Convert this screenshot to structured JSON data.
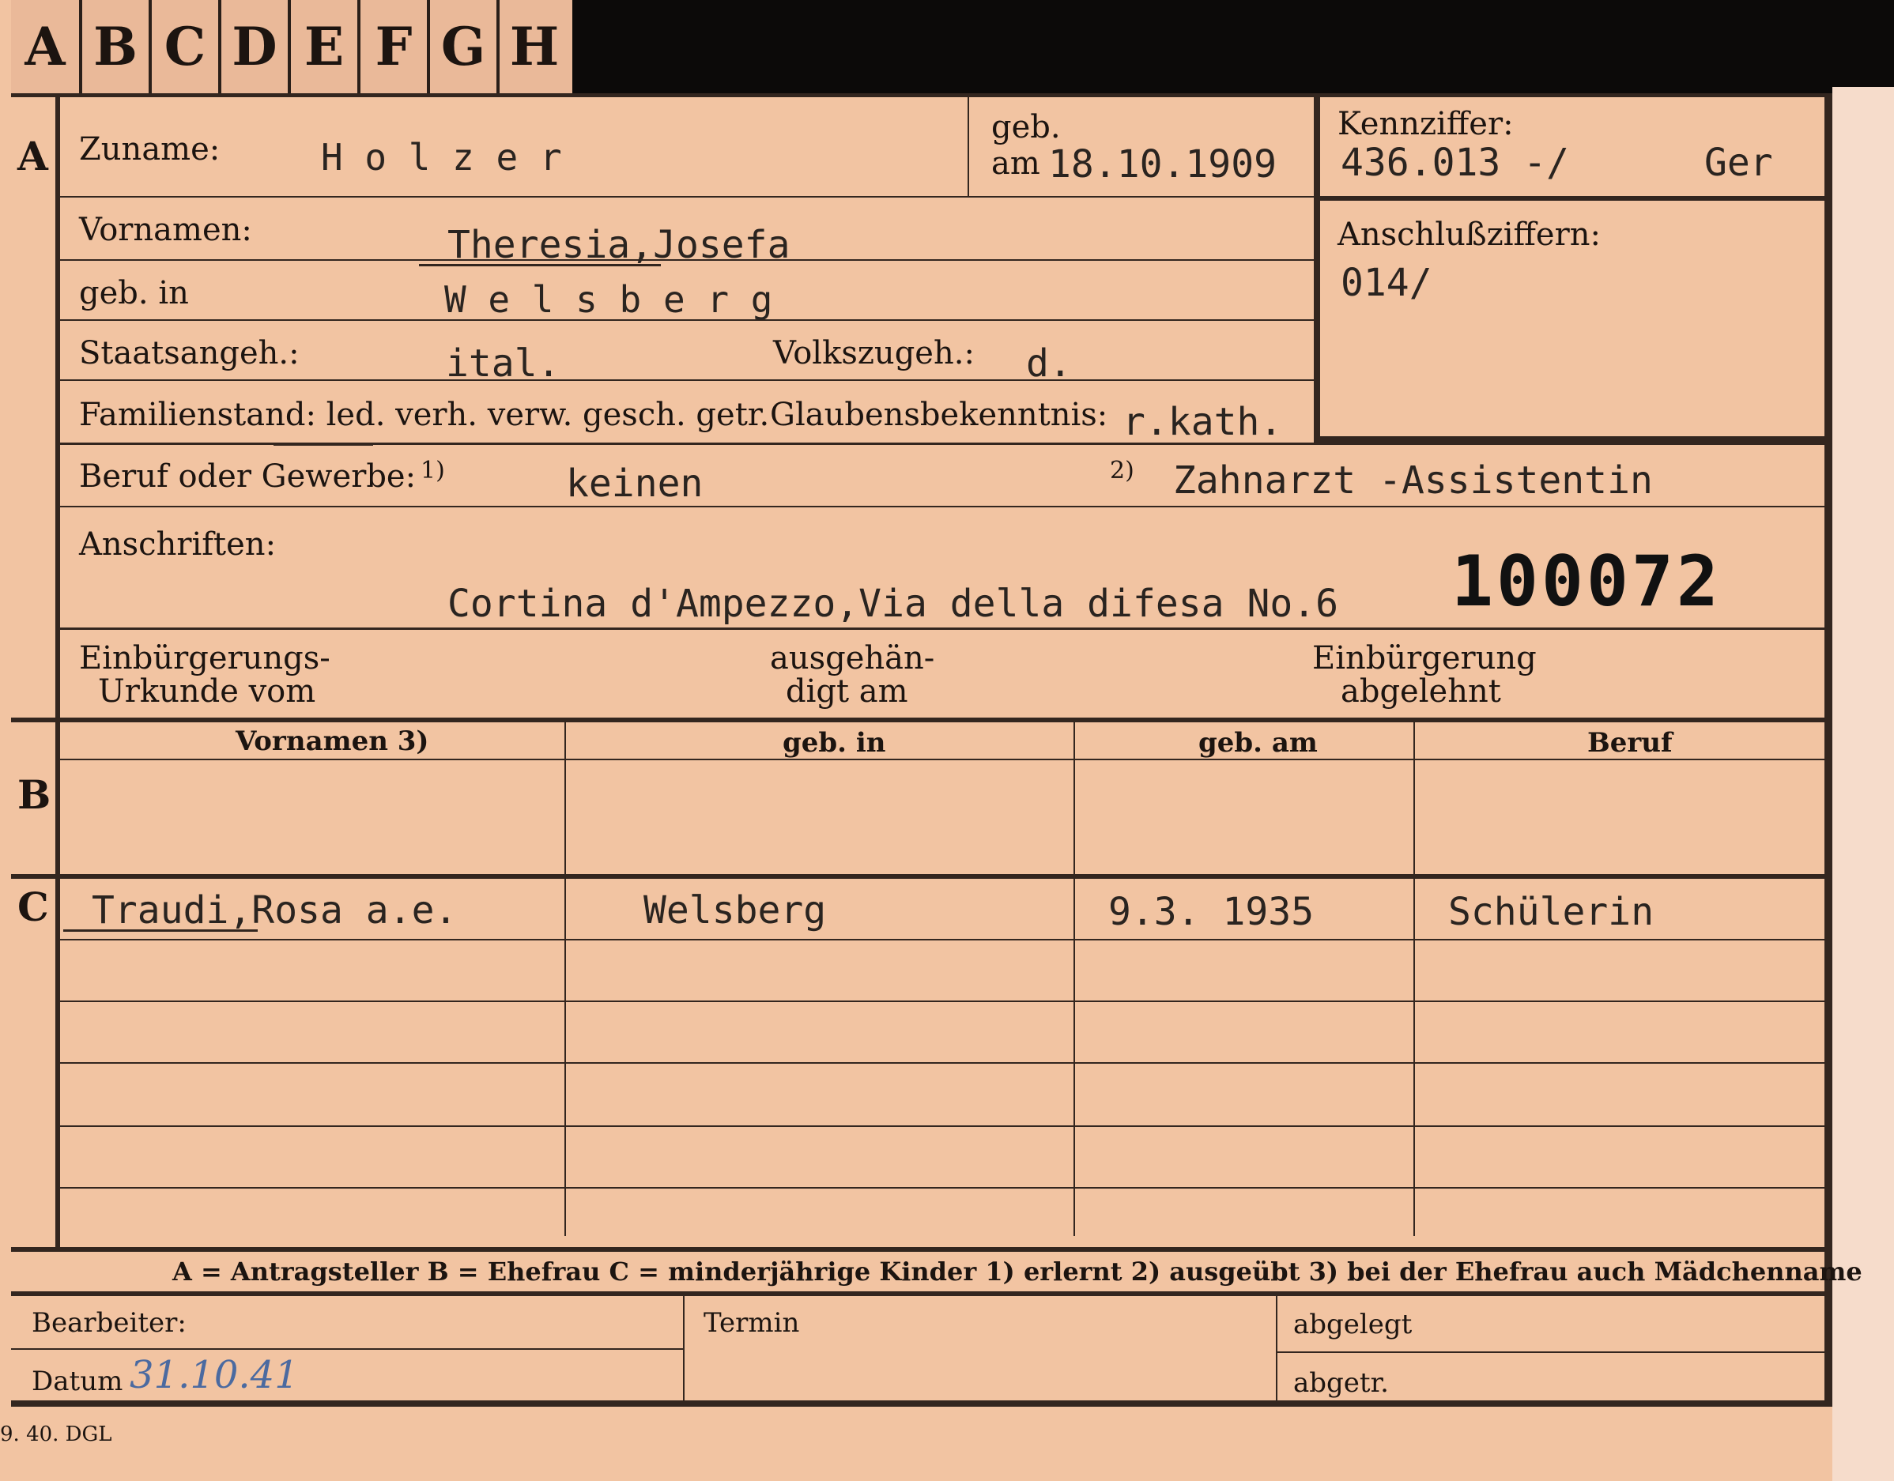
{
  "tabs": [
    "A",
    "B",
    "C",
    "D",
    "E",
    "F",
    "G",
    "H"
  ],
  "sections": {
    "a": "A",
    "b": "B",
    "c": "C"
  },
  "section_a": {
    "zuname_label": "Zuname:",
    "zuname_value": "H o l z e r",
    "geb_label": "geb.",
    "am_label": "am",
    "geb_am_value": "18.10.1909",
    "kennziffer_label": "Kennziffer:",
    "kennziffer_value": "436.013 -/",
    "kennziffer_suffix": "Ger",
    "vornamen_label": "Vornamen:",
    "vornamen_value": "Theresia,Josefa",
    "geb_in_label": "geb. in",
    "geb_in_value": "W e l s b e r g",
    "anschluss_label": "Anschlußziffern:",
    "anschluss_value": "014/",
    "staats_label": "Staatsangeh.:",
    "staats_value": "ital.",
    "volks_label": "Volkszugeh.:",
    "volks_value": "d.",
    "familien_label": "Familienstand: led. verh. verw. gesch. getr.",
    "glaubens_label": "Glaubensbekenntnis:",
    "glaubens_value": "r.kath.",
    "beruf_label": "Beruf oder Gewerbe:",
    "beruf_note1": "1)",
    "beruf_value1": "keinen",
    "beruf_note2": "2)",
    "beruf_value2": "Zahnarzt -Assistentin",
    "anschriften_label": "Anschriften:",
    "anschriften_value": "Cortina d'Ampezzo,Via della difesa No.6",
    "stamp_number": "100072",
    "einb_urkunde_l1": "Einbürgerungs-",
    "einb_urkunde_l2": "Urkunde vom",
    "ausgehaendigt_l1": "ausgehän-",
    "ausgehaendigt_l2": "digt am",
    "einb_abgelehnt_l1": "Einbürgerung",
    "einb_abgelehnt_l2": "abgelehnt"
  },
  "section_b": {
    "headers": [
      "Vornamen 3)",
      "geb. in",
      "geb. am",
      "Beruf"
    ]
  },
  "section_c": {
    "rows": [
      {
        "vornamen": "Traudi,Rosa a.e.",
        "geb_in": "Welsberg",
        "geb_am": "9.3. 1935",
        "beruf": "Schülerin"
      }
    ]
  },
  "legend": {
    "text": "A = Antragsteller   B = Ehefrau   C = minderjährige Kinder   1) erlernt   2) ausgeübt   3) bei der Ehefrau auch Mädchenname"
  },
  "footer": {
    "bearbeiter_label": "Bearbeiter:",
    "datum_label": "Datum",
    "datum_value": "31.10.41",
    "termin_label": "Termin",
    "abgelegt_label": "abgelegt",
    "abgetr_label": "abgetr."
  },
  "print_mark": "9. 40. DGL"
}
